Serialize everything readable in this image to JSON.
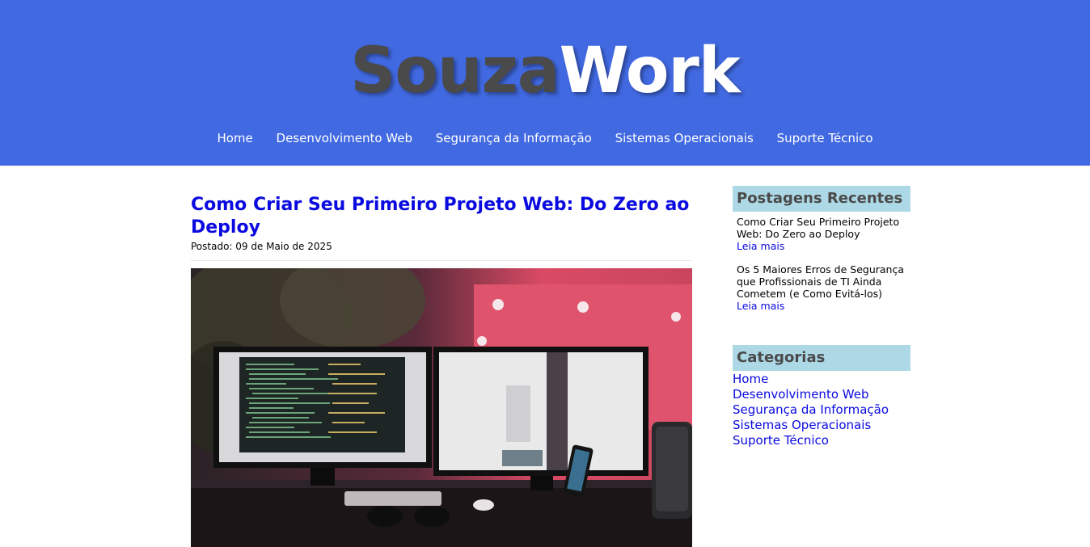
{
  "header": {
    "logo_part1": "Souza",
    "logo_part2": "Work",
    "nav": [
      "Home",
      "Desenvolvimento Web",
      "Segurança da Informação",
      "Sistemas Operacionais",
      "Suporte Técnico"
    ]
  },
  "post": {
    "title": "Como Criar Seu Primeiro Projeto Web: Do Zero ao Deploy",
    "date": "Postado: 09 de Maio de 2025"
  },
  "sidebar": {
    "recent_title": "Postagens Recentes",
    "recent": [
      {
        "title": "Como Criar Seu Primeiro Projeto Web: Do Zero ao Deploy",
        "link": "Leia mais"
      },
      {
        "title": "Os 5 Maiores Erros de Segurança que Profissionais de TI Ainda Cometem (e Como Evitá-los)",
        "link": "Leia mais"
      }
    ],
    "categories_title": "Categorias",
    "categories": [
      "Home",
      "Desenvolvimento Web",
      "Segurança da Informação",
      "Sistemas Operacionais",
      "Suporte Técnico"
    ]
  },
  "colors": {
    "header_bg": "#4169e1",
    "link": "#0a0ae0",
    "widget_title_bg": "#add8e6",
    "logo_dark": "#4a4a4a"
  }
}
